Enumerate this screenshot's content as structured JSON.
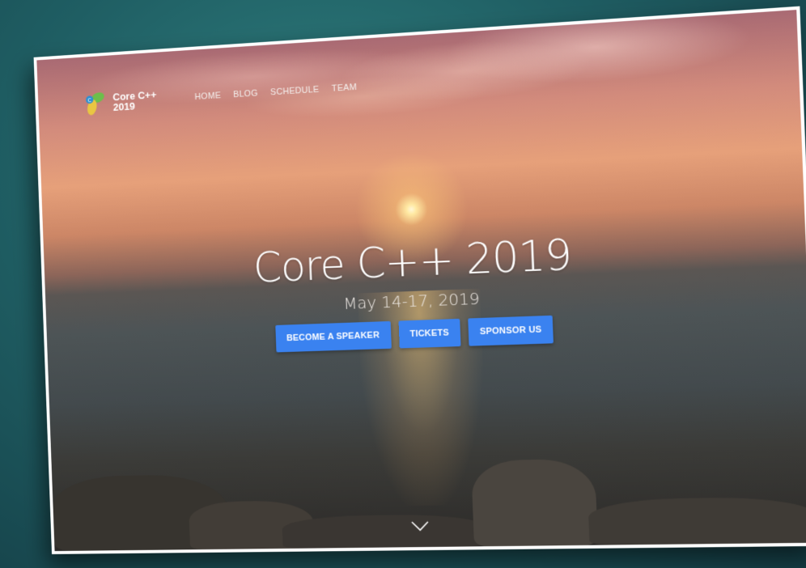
{
  "logo": {
    "text": "Core C++\n2019",
    "icon": "core-cpp-logo-icon"
  },
  "nav": {
    "items": [
      "HOME",
      "BLOG",
      "SCHEDULE",
      "TEAM"
    ]
  },
  "hero": {
    "title": "Core C++ 2019",
    "date": "May 14-17, 2019",
    "buttons": [
      "BECOME A SPEAKER",
      "TICKETS",
      "SPONSOR US"
    ],
    "scroll_icon": "chevron-down-icon"
  },
  "colors": {
    "button_bg": "#3a82f0",
    "logo_green": "#6cbf4b",
    "logo_yellow": "#e9c642",
    "logo_blue": "#2f8fd1"
  }
}
